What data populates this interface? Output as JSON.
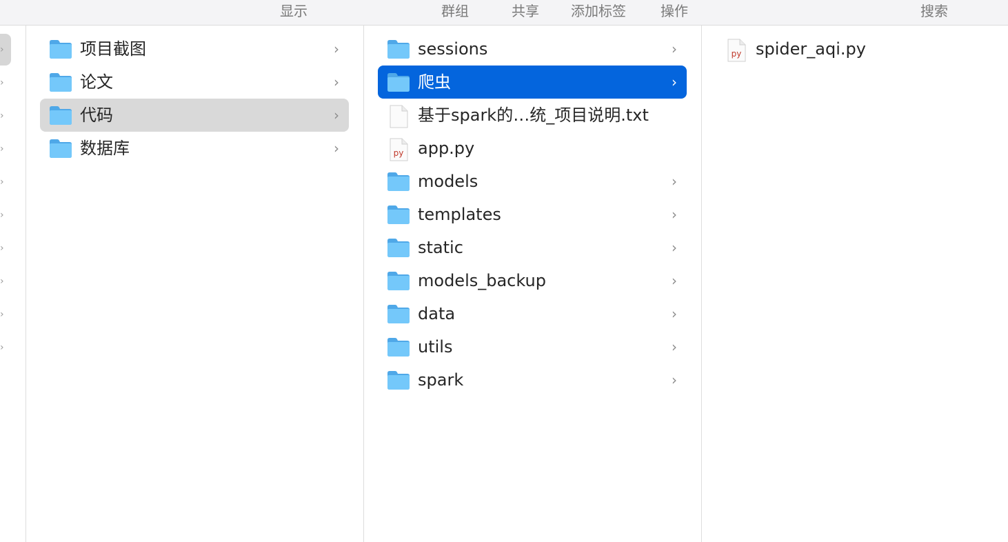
{
  "toolbar": {
    "view": "显示",
    "group": "群组",
    "share": "共享",
    "add_tag": "添加标签",
    "action": "操作",
    "search": "搜索"
  },
  "column1": {
    "items": [
      {
        "name": "项目截图",
        "type": "folder",
        "icon": "folder-icon"
      },
      {
        "name": "论文",
        "type": "folder",
        "icon": "folder-icon"
      },
      {
        "name": "代码",
        "type": "folder",
        "icon": "folder-icon",
        "selected": "inactive"
      },
      {
        "name": "数据库",
        "type": "folder",
        "icon": "folder-icon"
      }
    ]
  },
  "column2": {
    "items": [
      {
        "name": "sessions",
        "type": "folder",
        "icon": "folder-icon"
      },
      {
        "name": "爬虫",
        "type": "folder",
        "icon": "folder-icon",
        "selected": "active"
      },
      {
        "name": "基于spark的…统_项目说明.txt",
        "type": "file",
        "icon": "text-file-icon"
      },
      {
        "name": "app.py",
        "type": "file",
        "icon": "python-file-icon",
        "badge": "py"
      },
      {
        "name": "models",
        "type": "folder",
        "icon": "folder-icon"
      },
      {
        "name": "templates",
        "type": "folder",
        "icon": "folder-icon"
      },
      {
        "name": "static",
        "type": "folder",
        "icon": "folder-icon"
      },
      {
        "name": "models_backup",
        "type": "folder",
        "icon": "folder-icon"
      },
      {
        "name": "data",
        "type": "folder",
        "icon": "folder-icon"
      },
      {
        "name": "utils",
        "type": "folder",
        "icon": "folder-icon"
      },
      {
        "name": "spark",
        "type": "folder",
        "icon": "folder-icon"
      }
    ]
  },
  "column3": {
    "items": [
      {
        "name": "spider_aqi.py",
        "type": "file",
        "icon": "python-file-icon",
        "badge": "py"
      }
    ]
  },
  "colors": {
    "selection_active": "#0465dd",
    "selection_inactive": "#d9d9d9",
    "folder": "#6ec3f7"
  }
}
